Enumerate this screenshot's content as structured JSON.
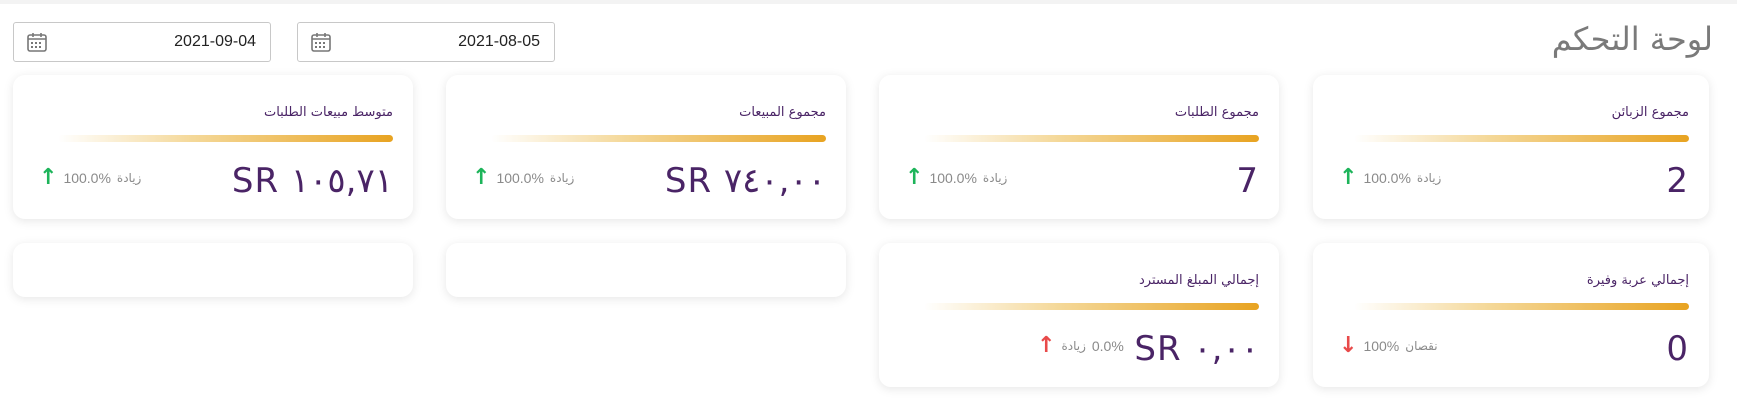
{
  "page": {
    "title": "لوحة التحكم"
  },
  "filters": {
    "date_from": "2021-08-05",
    "date_to": "2021-09-04"
  },
  "cards": {
    "customers": {
      "label": "مجموع الزبائن",
      "value": "2",
      "pct": "100.0%",
      "trend_word": "زيادة",
      "direction": "up"
    },
    "orders": {
      "label": "مجموع الطلبات",
      "value": "7",
      "pct": "100.0%",
      "trend_word": "زيادة",
      "direction": "up"
    },
    "sales": {
      "label": "مجموع المبيعات",
      "value": "SR ٧٤٠,٠٠",
      "pct": "100.0%",
      "trend_word": "زيادة",
      "direction": "up"
    },
    "avg_sales": {
      "label": "متوسط مبيعات الطلبات",
      "value": "SR ١٠٥,٧١",
      "pct": "100.0%",
      "trend_word": "زيادة",
      "direction": "up"
    },
    "abandoned": {
      "label": "إجمالي عربة وفيرة",
      "value": "0",
      "pct": "100%",
      "trend_word": "نقصان",
      "direction": "down"
    },
    "refunded": {
      "label": "إجمالي المبلغ المسترد",
      "value": "SR ٠,٠٠",
      "pct": "0.0%",
      "trend_word": "زيادة",
      "direction": "up"
    }
  },
  "colors": {
    "accent_text": "#4a2466",
    "bar": "#e8a321",
    "up": "#1db45a",
    "down": "#e84a4a"
  }
}
